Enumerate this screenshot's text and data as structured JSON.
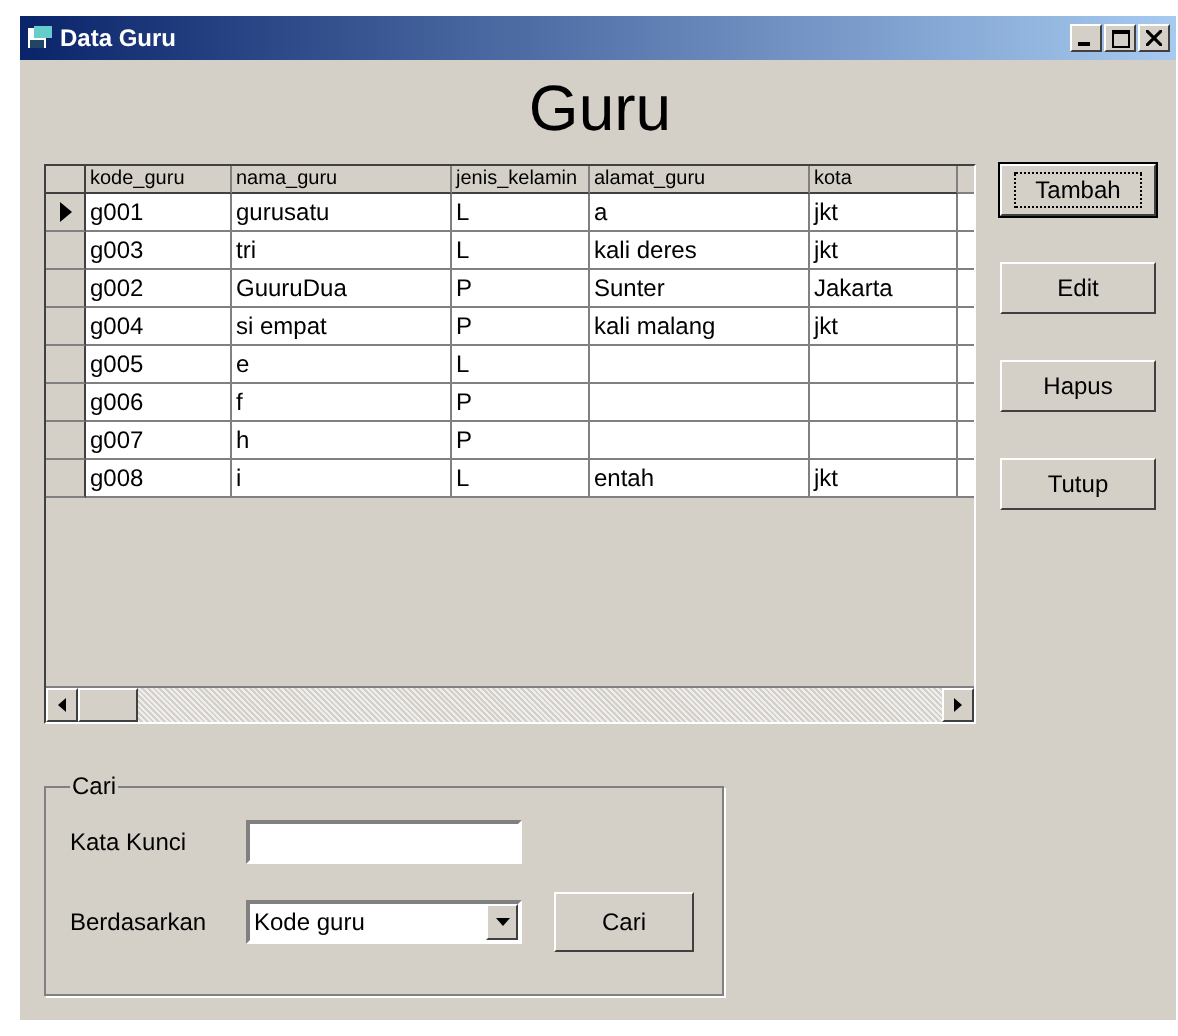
{
  "window": {
    "title": "Data Guru"
  },
  "heading": "Guru",
  "table": {
    "columns": [
      "kode_guru",
      "nama_guru",
      "jenis_kelamin",
      "alamat_guru",
      "kota"
    ],
    "rows": [
      {
        "selected": true,
        "cells": [
          "g001",
          "gurusatu",
          "L",
          "a",
          "jkt"
        ]
      },
      {
        "selected": false,
        "cells": [
          "g003",
          "tri",
          "L",
          "kali deres",
          "jkt"
        ]
      },
      {
        "selected": false,
        "cells": [
          "g002",
          "GuuruDua",
          "P",
          "Sunter",
          "Jakarta"
        ]
      },
      {
        "selected": false,
        "cells": [
          "g004",
          "si empat",
          "P",
          "kali malang",
          "jkt"
        ]
      },
      {
        "selected": false,
        "cells": [
          "g005",
          "e",
          "L",
          "",
          ""
        ]
      },
      {
        "selected": false,
        "cells": [
          "g006",
          "f",
          "P",
          "",
          ""
        ]
      },
      {
        "selected": false,
        "cells": [
          "g007",
          "h",
          "P",
          "",
          ""
        ]
      },
      {
        "selected": false,
        "cells": [
          "g008",
          "i",
          "L",
          "entah",
          "jkt"
        ]
      }
    ]
  },
  "buttons": [
    {
      "label": "Tambah",
      "focused": true
    },
    {
      "label": "Edit",
      "focused": false
    },
    {
      "label": "Hapus",
      "focused": false
    },
    {
      "label": "Tutup",
      "focused": false
    }
  ],
  "search": {
    "title": "Cari",
    "keyword_label": "Kata Kunci",
    "by_label": "Berdasarkan",
    "by_value": "Kode guru",
    "button": "Cari"
  }
}
